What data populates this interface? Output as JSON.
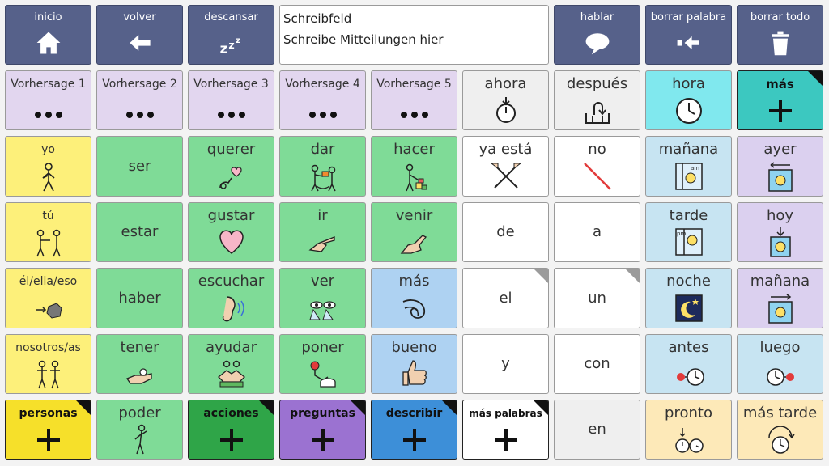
{
  "topbar": {
    "inicio": "inicio",
    "volver": "volver",
    "descansar": "descansar",
    "hablar": "hablar",
    "borrar_palabra": "borrar palabra",
    "borrar_todo": "borrar todo"
  },
  "message": {
    "title": "Schreibfeld",
    "placeholder": "Schreibe Mitteilungen hier"
  },
  "grid": {
    "row1": [
      "Vorhersage 1",
      "Vorhersage 2",
      "Vorhersage 3",
      "Vorhersage 4",
      "Vorhersage 5",
      "ahora",
      "después",
      "hora",
      "más"
    ],
    "row2": [
      "yo",
      "ser",
      "querer",
      "dar",
      "hacer",
      "ya está",
      "no",
      "mañana",
      "ayer"
    ],
    "row3": [
      "tú",
      "estar",
      "gustar",
      "ir",
      "venir",
      "de",
      "a",
      "tarde",
      "hoy"
    ],
    "row4": [
      "él/ella/eso",
      "haber",
      "escuchar",
      "ver",
      "más",
      "el",
      "un",
      "noche",
      "mañana"
    ],
    "row5": [
      "nosotros/as",
      "tener",
      "ayudar",
      "poner",
      "bueno",
      "y",
      "con",
      "antes",
      "luego"
    ],
    "row6": [
      "personas",
      "poder",
      "acciones",
      "preguntas",
      "describir",
      "más palabras",
      "en",
      "pronto",
      "más tarde"
    ]
  },
  "icons": {
    "home": "home-icon",
    "back": "arrow-left-icon",
    "sleep": "zzz-icon",
    "speak": "speech-bubble-icon",
    "delete_word": "backspace-icon",
    "delete_all": "trash-icon"
  }
}
